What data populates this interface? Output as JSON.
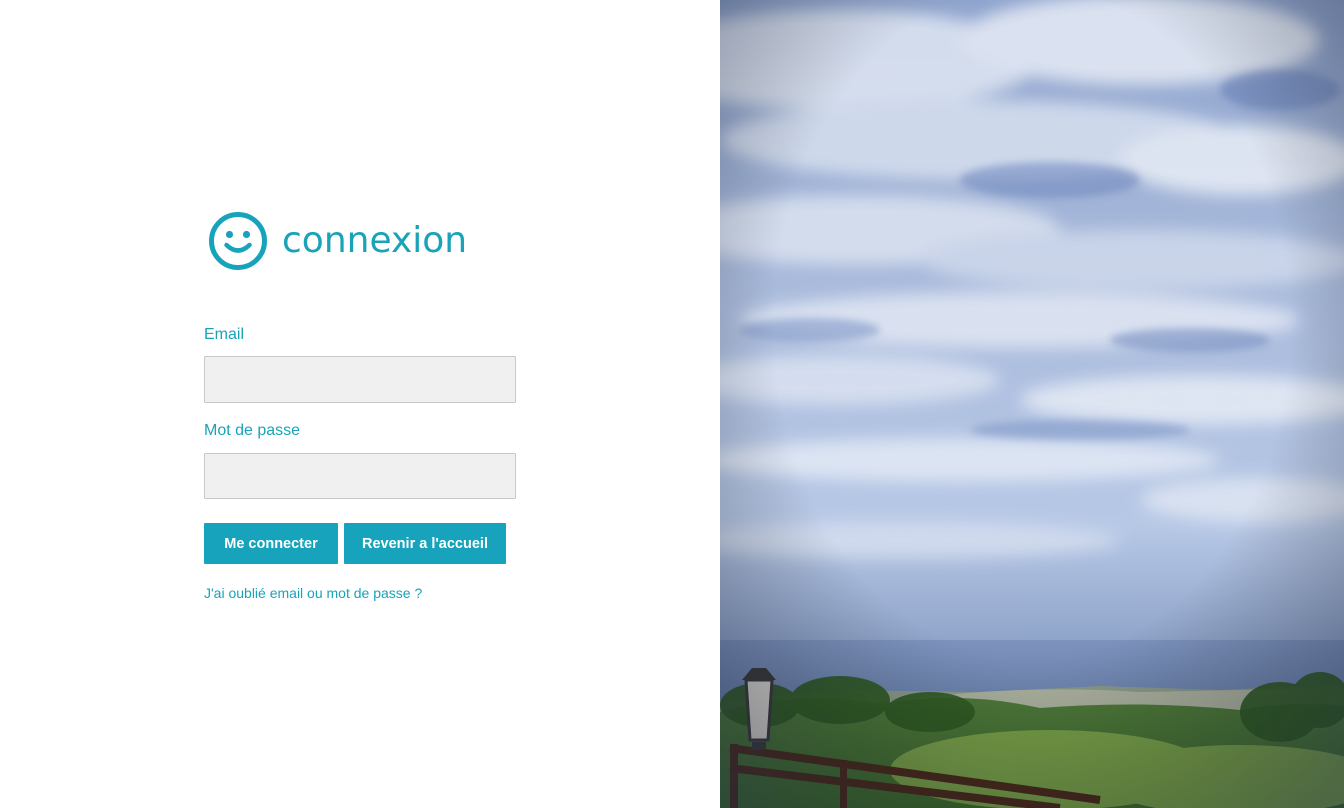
{
  "login": {
    "title": "connexion",
    "email_label": "Email",
    "email_value": "",
    "password_label": "Mot de passe",
    "password_value": "",
    "login_button": "Me connecter",
    "home_button": "Revenir a l'accueil",
    "forgot_link": "J'ai oublié email ou mot de passe ?"
  },
  "icons": {
    "brand": "smiley-face-icon"
  },
  "colors": {
    "accent": "#16a3bb",
    "input_bg": "#f0f0f0",
    "input_border": "#c8c8c8"
  }
}
